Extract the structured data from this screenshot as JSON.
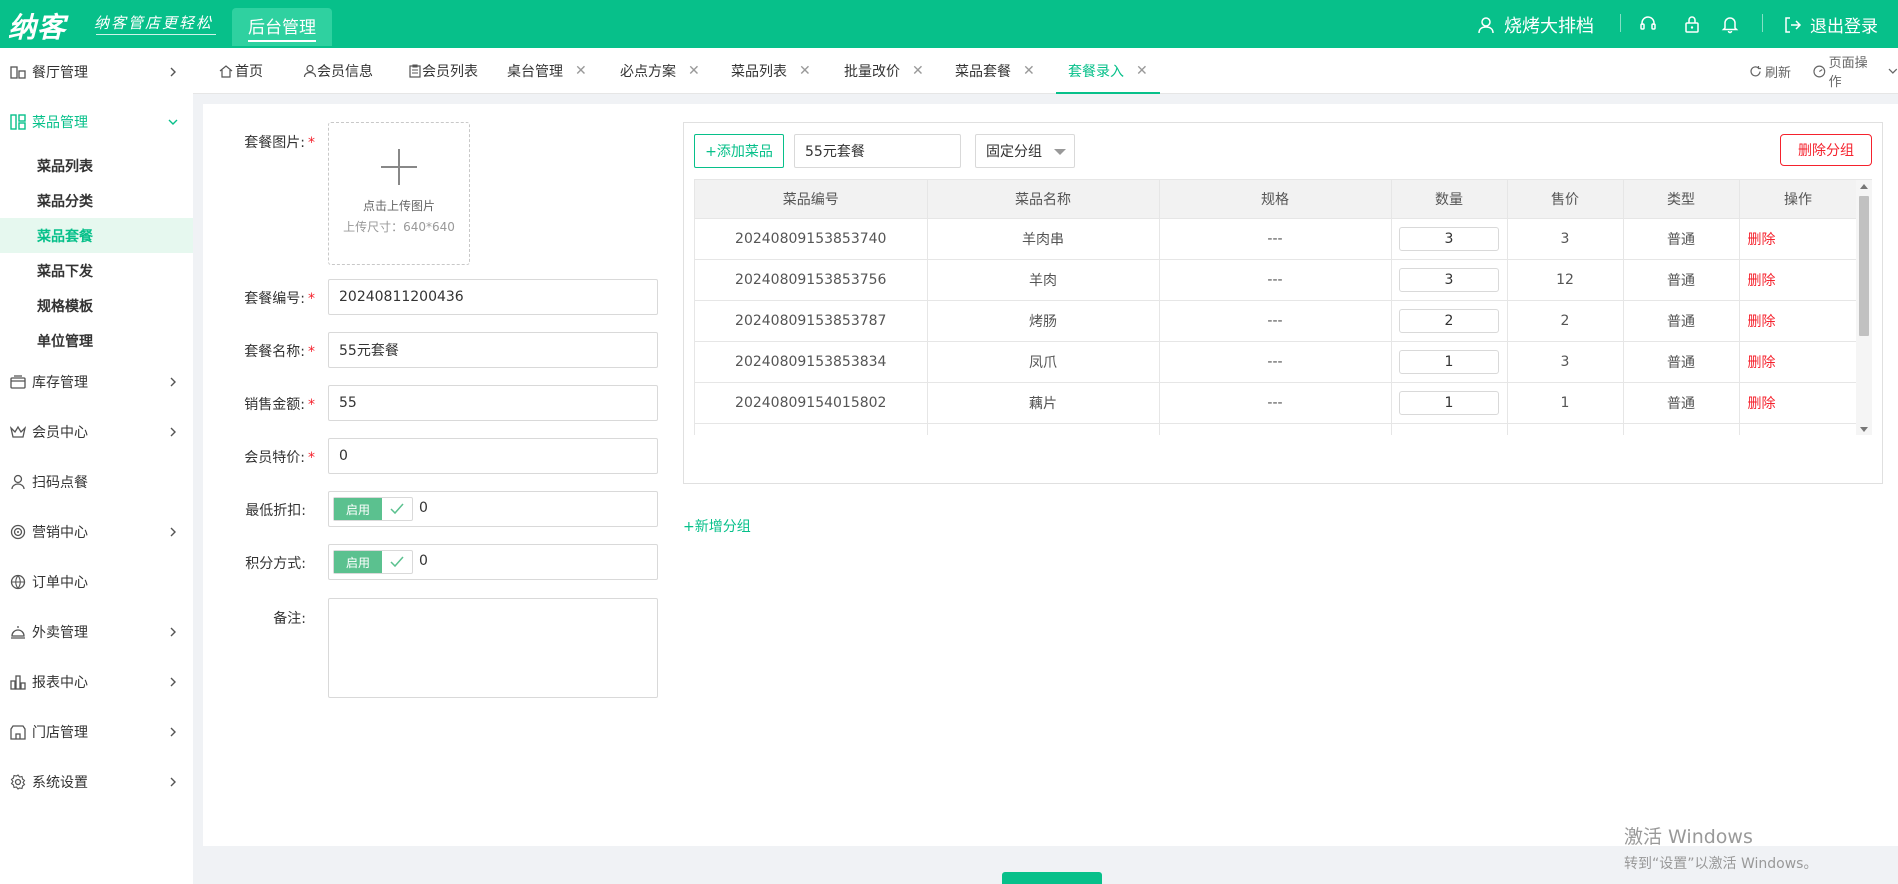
{
  "header": {
    "logo": "纳客",
    "slogan": "纳客管店更轻松",
    "module_tab": "后台管理",
    "store_name": "烧烤大排档",
    "logout_label": "退出登录",
    "icons": [
      "headset-icon",
      "lock-icon",
      "bell-icon"
    ]
  },
  "sidebar": {
    "items": [
      {
        "label": "餐厅管理",
        "icon": "restaurant-icon"
      },
      {
        "label": "菜品管理",
        "icon": "dishes-icon",
        "expanded": true
      },
      {
        "label": "库存管理",
        "icon": "inventory-icon"
      },
      {
        "label": "会员中心",
        "icon": "crown-icon"
      },
      {
        "label": "扫码点餐",
        "icon": "user-icon"
      },
      {
        "label": "营销中心",
        "icon": "target-icon"
      },
      {
        "label": "订单中心",
        "icon": "globe-icon"
      },
      {
        "label": "外卖管理",
        "icon": "delivery-bell-icon"
      },
      {
        "label": "报表中心",
        "icon": "report-icon"
      },
      {
        "label": "门店管理",
        "icon": "store-icon"
      },
      {
        "label": "系统设置",
        "icon": "gear-icon"
      }
    ],
    "sub_items": [
      {
        "label": "菜品列表"
      },
      {
        "label": "菜品分类"
      },
      {
        "label": "菜品套餐",
        "active": true
      },
      {
        "label": "菜品下发"
      },
      {
        "label": "规格模板"
      },
      {
        "label": "单位管理"
      }
    ]
  },
  "tabs": {
    "items": [
      {
        "label": "首页",
        "closable": false
      },
      {
        "label": "会员信息",
        "closable": false
      },
      {
        "label": "会员列表",
        "closable": false
      },
      {
        "label": "桌台管理",
        "closable": true
      },
      {
        "label": "必点方案",
        "closable": true
      },
      {
        "label": "菜品列表",
        "closable": true
      },
      {
        "label": "批量改价",
        "closable": true
      },
      {
        "label": "菜品套餐",
        "closable": true
      },
      {
        "label": "套餐录入",
        "closable": true,
        "active": true
      }
    ],
    "refresh_label": "刷新",
    "page_ops_label": "页面操作"
  },
  "form": {
    "image_label": "套餐图片:",
    "upload_text": "点击上传图片",
    "upload_size": "上传尺寸：640*640",
    "code_label": "套餐编号:",
    "code_value": "20240811200436",
    "name_label": "套餐名称:",
    "name_value": "55元套餐",
    "price_label": "销售金额:",
    "price_value": "55",
    "member_price_label": "会员特价:",
    "member_price_value": "0",
    "min_discount_label": "最低折扣:",
    "min_discount_switch": "启用",
    "min_discount_value": "0",
    "points_label": "积分方式:",
    "points_switch": "启用",
    "points_value": "0",
    "remark_label": "备注:",
    "remark_value": ""
  },
  "group": {
    "add_dish_label": "+添加菜品",
    "group_name": "55元套餐",
    "group_type": "固定分组",
    "delete_group_label": "删除分组",
    "columns": [
      "菜品编号",
      "菜品名称",
      "规格",
      "数量",
      "售价",
      "类型",
      "操作"
    ],
    "rows": [
      {
        "code": "20240809153853740",
        "name": "羊肉串",
        "spec": "---",
        "qty": "3",
        "price": "3",
        "type": "普通",
        "op": "删除"
      },
      {
        "code": "20240809153853756",
        "name": "羊肉",
        "spec": "---",
        "qty": "3",
        "price": "12",
        "type": "普通",
        "op": "删除"
      },
      {
        "code": "20240809153853787",
        "name": "烤肠",
        "spec": "---",
        "qty": "2",
        "price": "2",
        "type": "普通",
        "op": "删除"
      },
      {
        "code": "20240809153853834",
        "name": "凤爪",
        "spec": "---",
        "qty": "1",
        "price": "3",
        "type": "普通",
        "op": "删除"
      },
      {
        "code": "20240809154015802",
        "name": "藕片",
        "spec": "---",
        "qty": "1",
        "price": "1",
        "type": "普通",
        "op": "删除"
      }
    ]
  },
  "add_group_label": "+新增分组",
  "watermark": {
    "line1": "激活 Windows",
    "line2": "转到“设置”以激活 Windows。"
  },
  "colors": {
    "accent": "#07c08a",
    "danger": "#f5222d"
  }
}
